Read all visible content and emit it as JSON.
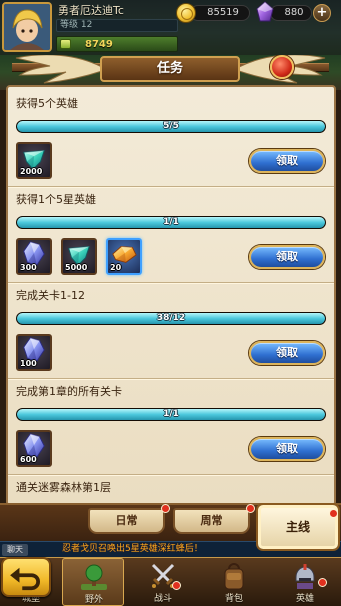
{
  "header": {
    "player_name": "勇者厄达迪Tc",
    "level_label": "等级 12",
    "power": "8749",
    "gold": "85519",
    "gems": "880",
    "add_label": "+"
  },
  "title": "任务",
  "quests": [
    {
      "title": "获得5个英雄",
      "progress_text": "5/5",
      "progress": 1,
      "button": "领取",
      "rewards": [
        {
          "icon": "green-gem-icon",
          "amount": "2000"
        }
      ]
    },
    {
      "title": "获得1个5星英雄",
      "progress_text": "1/1",
      "progress": 1,
      "button": "领取",
      "rewards": [
        {
          "icon": "blue-gem-icon",
          "amount": "300"
        },
        {
          "icon": "green-gem-icon",
          "amount": "5000"
        },
        {
          "icon": "orange-gem-icon",
          "amount": "20",
          "highlighted": true
        }
      ]
    },
    {
      "title": "完成关卡1-12",
      "progress_text": "38/12",
      "progress": 1,
      "button": "领取",
      "rewards": [
        {
          "icon": "blue-gem-icon",
          "amount": "100"
        }
      ]
    },
    {
      "title": "完成第1章的所有关卡",
      "progress_text": "1/1",
      "progress": 1,
      "button": "领取",
      "rewards": [
        {
          "icon": "blue-gem-icon",
          "amount": "600"
        }
      ]
    },
    {
      "title": "通关迷雾森林第1层"
    }
  ],
  "tabs": [
    {
      "label": "日常",
      "badge": true
    },
    {
      "label": "周常",
      "badge": true
    },
    {
      "label": "主线",
      "active": true,
      "badge": true
    }
  ],
  "chat": {
    "label": "聊天",
    "message": "忍者戈贝召唤出5星英雄深红蜂后！"
  },
  "nav": [
    {
      "label": "城堡",
      "icon": "castle-icon"
    },
    {
      "label": "野外",
      "icon": "field-icon",
      "active": true
    },
    {
      "label": "战斗",
      "icon": "crossed-swords-icon",
      "badge": true
    },
    {
      "label": "背包",
      "icon": "backpack-icon"
    },
    {
      "label": "英雄",
      "icon": "hero-helmet-icon",
      "badge": true
    }
  ],
  "icons": {
    "header": [
      "player-avatar",
      "power-icon",
      "gold-coin-icon",
      "purple-gem-icon"
    ],
    "back": "back-arrow-icon"
  },
  "colors": {
    "panel": "#efe4cb",
    "progress_fill": "#4cc8dc",
    "claim_button": "#2f6fd0",
    "badge": "#e0301e",
    "tab_active": "#fff6de"
  }
}
